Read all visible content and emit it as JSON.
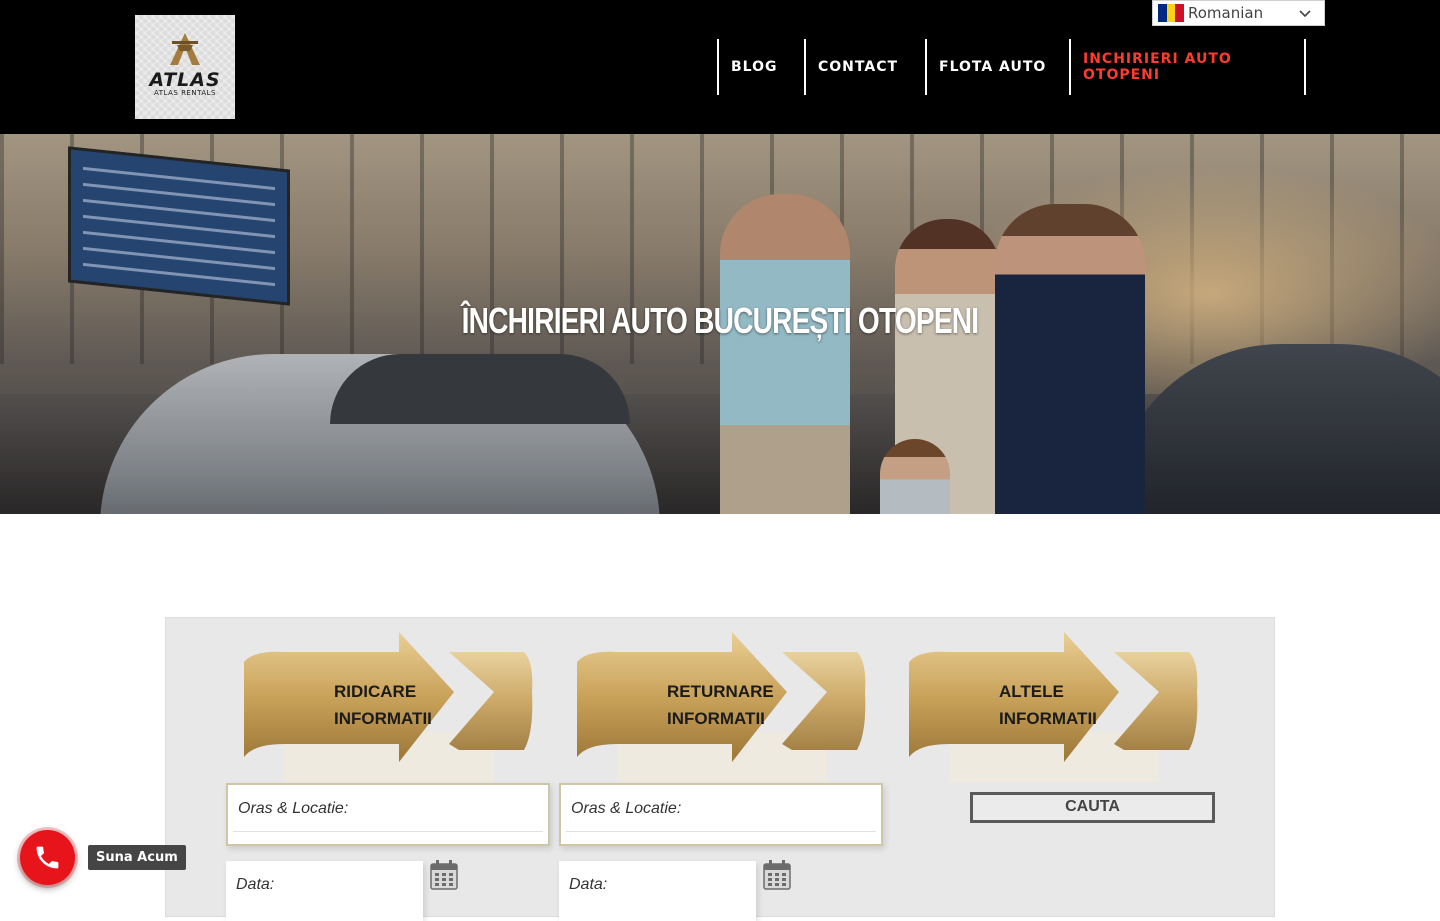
{
  "header": {
    "logo": {
      "name": "ATLAS",
      "subtitle": "ATLAS RENTALS"
    },
    "nav": [
      {
        "label": "BLOG"
      },
      {
        "label": "CONTACT"
      },
      {
        "label": "FLOTA AUTO"
      },
      {
        "label": "INCHIRIERI AUTO OTOPENI",
        "active": true
      }
    ],
    "language": {
      "selected": "Romanian",
      "flag_colors": [
        "#002B7F",
        "#FCD116",
        "#CE1126"
      ]
    }
  },
  "hero": {
    "title": "ÎNCHIRIERI AUTO BUCUREȘTI OTOPENI"
  },
  "booking": {
    "pickup": {
      "heading_line1": "RIDICARE",
      "heading_line2": "INFORMATII",
      "location_placeholder": "Oras & Locatie:",
      "date_placeholder": "Data:"
    },
    "return": {
      "heading_line1": "RETURNARE",
      "heading_line2": "INFORMATII",
      "location_placeholder": "Oras & Locatie:",
      "date_placeholder": "Data:"
    },
    "other": {
      "heading_line1": "ALTELE",
      "heading_line2": "INFORMATII",
      "search_label": "CAUTA"
    }
  },
  "call_widget": {
    "label": "Suna Acum",
    "color": "#e8141c"
  },
  "colors": {
    "accent": "#ff3b2f",
    "header_bg": "#000000",
    "ribbon_gold": "#c9a25a"
  },
  "icons": [
    "calendar-icon",
    "phone-icon",
    "chevron-down-icon"
  ]
}
